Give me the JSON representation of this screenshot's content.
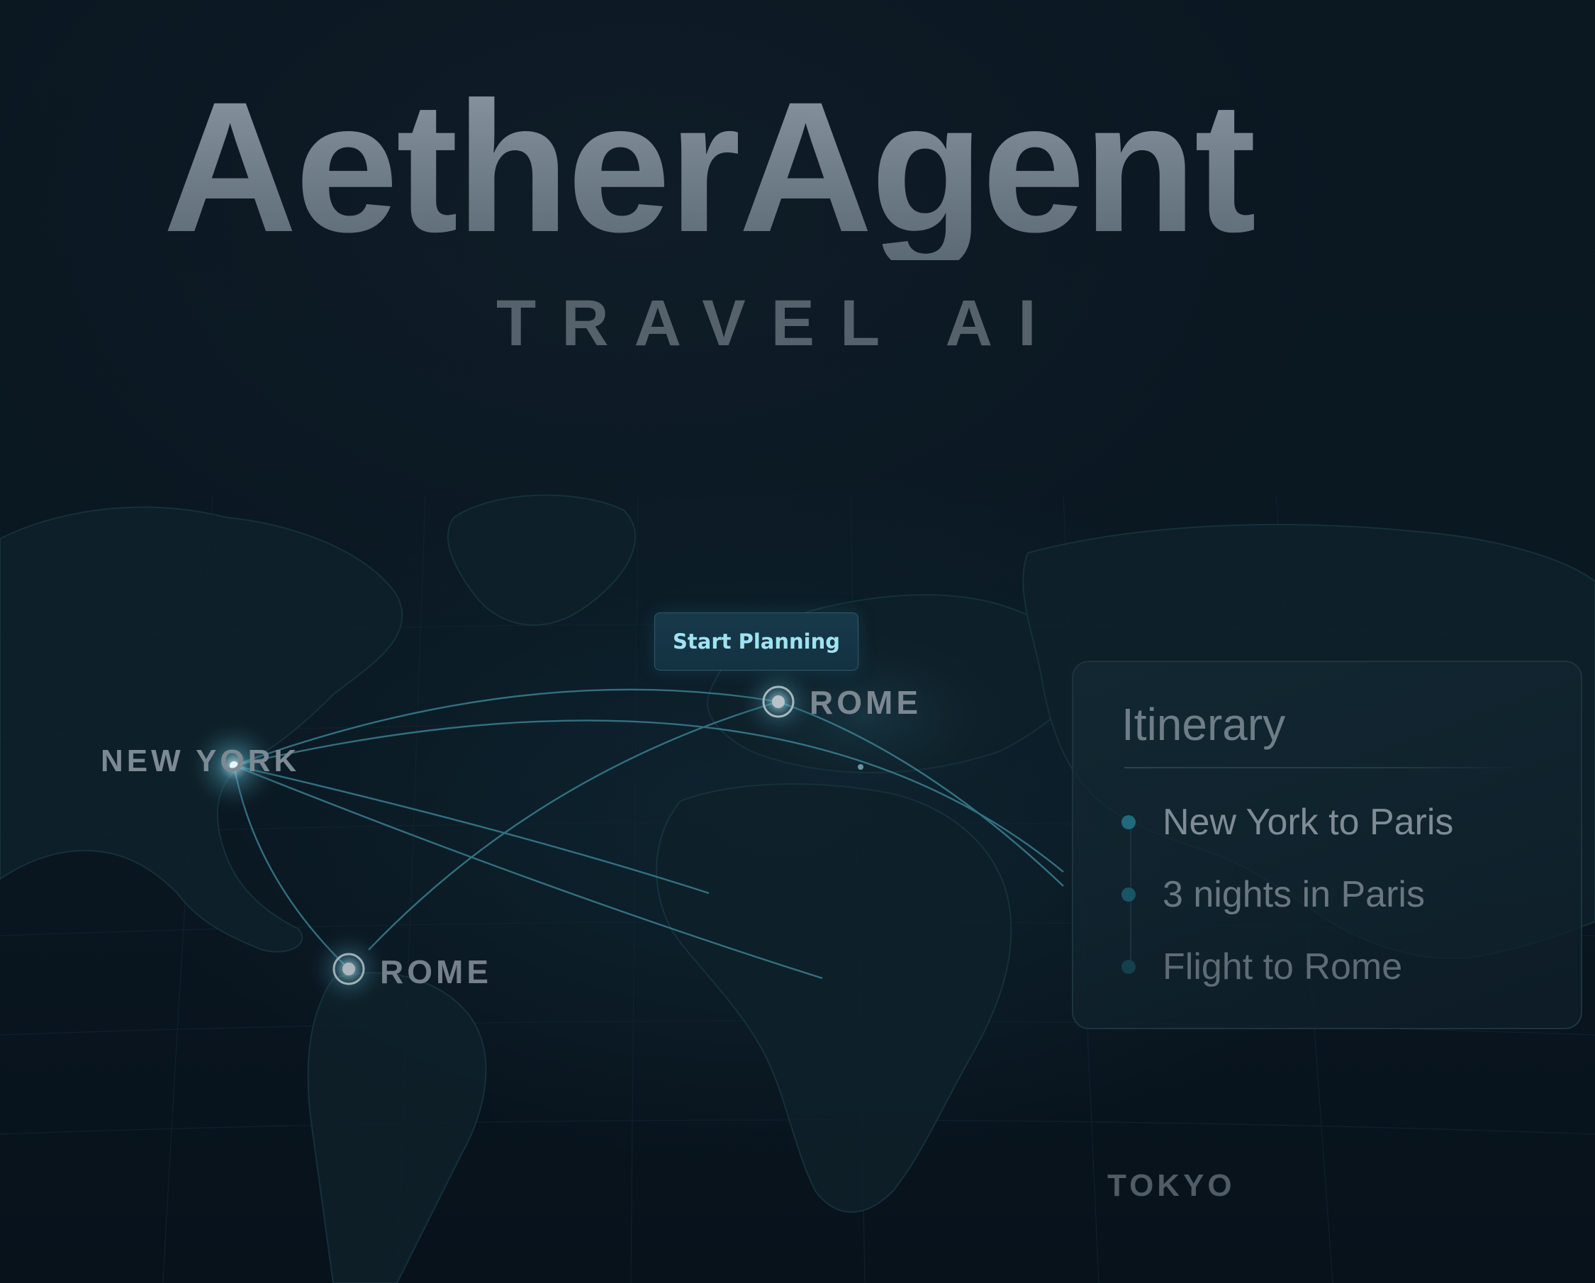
{
  "brand": {
    "title": "AetherAgent",
    "subtitle": "TRAVEL AI"
  },
  "actions": {
    "start_label": "Start Planning"
  },
  "map": {
    "cities": {
      "new_york": "NEW YORK",
      "rome_europe": "ROME",
      "rome_south": "ROME",
      "tokyo": "TOKYO"
    }
  },
  "itinerary": {
    "title": "Itinerary",
    "items": [
      "New York to Paris",
      "3 nights in Paris",
      "Flight to Rome"
    ]
  },
  "colors": {
    "background": "#0a1620",
    "accent": "#9fe3f2",
    "route": "#3f8d9e",
    "marker": "#a9b6bd",
    "dot_active": "#1f6a7b"
  },
  "icons": {
    "city_marker": "target-marker-icon",
    "itinerary_bullet": "dot-icon"
  }
}
